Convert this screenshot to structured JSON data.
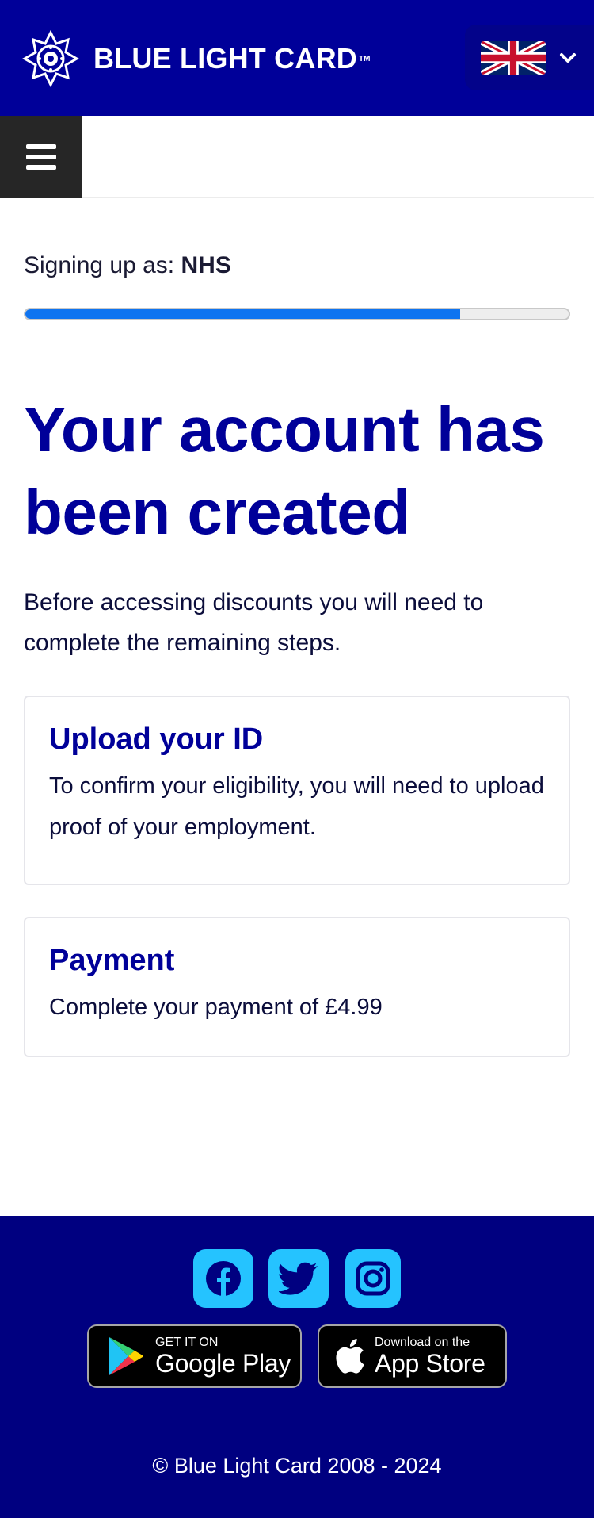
{
  "header": {
    "brand": "BLUE LIGHT CARD",
    "brand_tm": "TM",
    "language_flag": "uk-flag-icon",
    "language_toggle_icon": "chevron-down-icon"
  },
  "nav": {
    "menu_icon": "hamburger-menu-icon"
  },
  "signup": {
    "label": "Signing up as: ",
    "value": "NHS"
  },
  "progress": {
    "fraction": 0.8,
    "fill_color": "#0f74f0"
  },
  "main": {
    "title": "Your account has been created",
    "intro": "Before accessing discounts you will need to complete the remaining steps."
  },
  "steps": [
    {
      "title": "Upload your ID",
      "description": "To confirm your eligibility, you will need to upload proof of your employment."
    },
    {
      "title": "Payment",
      "description": "Complete your payment of £4.99"
    }
  ],
  "footer": {
    "social": [
      "facebook-icon",
      "twitter-icon",
      "instagram-icon"
    ],
    "google_play": {
      "small": "GET IT ON",
      "big": "Google Play"
    },
    "app_store": {
      "small": "Download on the",
      "big": "App Store"
    },
    "copyright": "© Blue Light Card 2008 - 2024"
  },
  "colors": {
    "brand_blue": "#000099",
    "footer_blue": "#000080",
    "social_cyan": "#25c3ff"
  }
}
